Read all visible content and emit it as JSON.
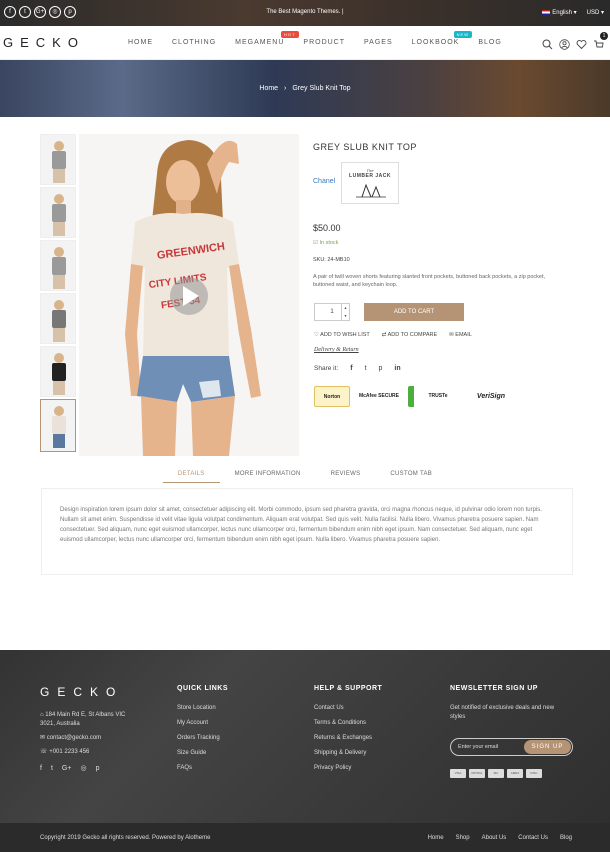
{
  "topbar": {
    "socials": [
      "f",
      "t",
      "G+",
      "◎",
      "p"
    ],
    "promo": "The Best Magento Themes. |",
    "language": "English",
    "currency": "USD"
  },
  "header": {
    "logo": "GECKO",
    "nav": [
      {
        "label": "HOME",
        "badge": null
      },
      {
        "label": "CLOTHING",
        "badge": null
      },
      {
        "label": "MEGAMENU",
        "badge": "HOT",
        "badge_color": "#e74c3c"
      },
      {
        "label": "PRODUCT",
        "badge": null
      },
      {
        "label": "PAGES",
        "badge": null
      },
      {
        "label": "LOOKBOOK",
        "badge": "NEW",
        "badge_color": "#1ab6c9"
      },
      {
        "label": "BLOG",
        "badge": null
      }
    ],
    "cart_count": "1"
  },
  "breadcrumb": {
    "home": "Home",
    "sep": "›",
    "current": "Grey Slub Knit Top"
  },
  "product": {
    "title": "GREY SLUB KNIT TOP",
    "brand": "Chanel",
    "brand_logo_text": [
      "The",
      "LUMBER JACK"
    ],
    "price": "$50.00",
    "stock": "In stock",
    "sku_label": "SKU:",
    "sku": "24-MB10",
    "description": "A pair of twill woven shorts featuring slanted front pockets, buttoned back pockets, a zip pocket, buttoned waist, and keychain loop.",
    "qty": "1",
    "add_to_cart": "ADD TO CART",
    "wishlist": "ADD TO WISH LIST",
    "compare": "ADD TO COMPARE",
    "email": "EMAIL",
    "delivery": "Delivery & Return",
    "share_label": "Share it:",
    "share_icons": [
      "f",
      "t",
      "p",
      "in"
    ],
    "shirt_text": [
      "GREENWICH",
      "CITY LIMITS",
      "FEST 54"
    ],
    "trust": [
      "Norton",
      "McAfee SECURE",
      "TRUSTe",
      "VeriSign"
    ]
  },
  "tabs": [
    {
      "label": "DETAILS",
      "active": true
    },
    {
      "label": "MORE INFORMATION",
      "active": false
    },
    {
      "label": "REVIEWS",
      "active": false
    },
    {
      "label": "CUSTOM TAB",
      "active": false
    }
  ],
  "details_text": "Design inspiration lorem ipsum dolor sit amet, consectetuer adipiscing elit. Morbi commodo, ipsum sed pharetra gravida, orci magna rhoncus neque, id pulvinar odio lorem non turpis. Nullam sit amet enim. Suspendisse id velit vitae ligula volutpat condimentum. Aliquam erat volutpat. Sed quis velit. Nulla facilisi. Nulla libero. Vivamus pharetra posuere sapien. Nam consectetuer. Sed aliquam, nunc eget euismod ullamcorper, lectus nunc ullamcorper orci, fermentum bibendum enim nibh eget ipsum. Nam consectetuer. Sed aliquam, nunc eget euismod ullamcorper, lectus nunc ullamcorper orci, fermentum bibendum enim nibh eget ipsum. Nulla libero. Vivamus pharetra posuere sapien.",
  "footer": {
    "logo": "GECKO",
    "address": "184 Main Rd E, St Albans VIC 3021, Australia",
    "email": "contact@gecko.com",
    "phone": "+001 2233 456",
    "socials": [
      "f",
      "t",
      "G+",
      "◎",
      "p"
    ],
    "quick_links_title": "QUICK LINKS",
    "quick_links": [
      "Store Location",
      "My Account",
      "Orders Tracking",
      "Size Guide",
      "FAQs"
    ],
    "help_title": "HELP & SUPPORT",
    "help_links": [
      "Contact Us",
      "Terms & Conditions",
      "Returns & Exchanges",
      "Shipping & Delivery",
      "Privacy Policy"
    ],
    "newsletter_title": "NEWSLETTER SIGN UP",
    "newsletter_text": "Get notified of exclusive deals and new styles",
    "email_placeholder": "Enter your email",
    "signup": "SIGN UP",
    "payments": [
      "VISA",
      "PAYPAL",
      "MC",
      "AMEX",
      "DISC"
    ],
    "copyright": "Copyright 2019 Gecko all rights reserved. Powered by Alotheme",
    "bottom_links": [
      "Home",
      "Shop",
      "About Us",
      "Contact Us",
      "Blog"
    ]
  },
  "colors": {
    "accent": "#b49474",
    "link": "#3a7bbd",
    "instock": "#7aa05a"
  }
}
